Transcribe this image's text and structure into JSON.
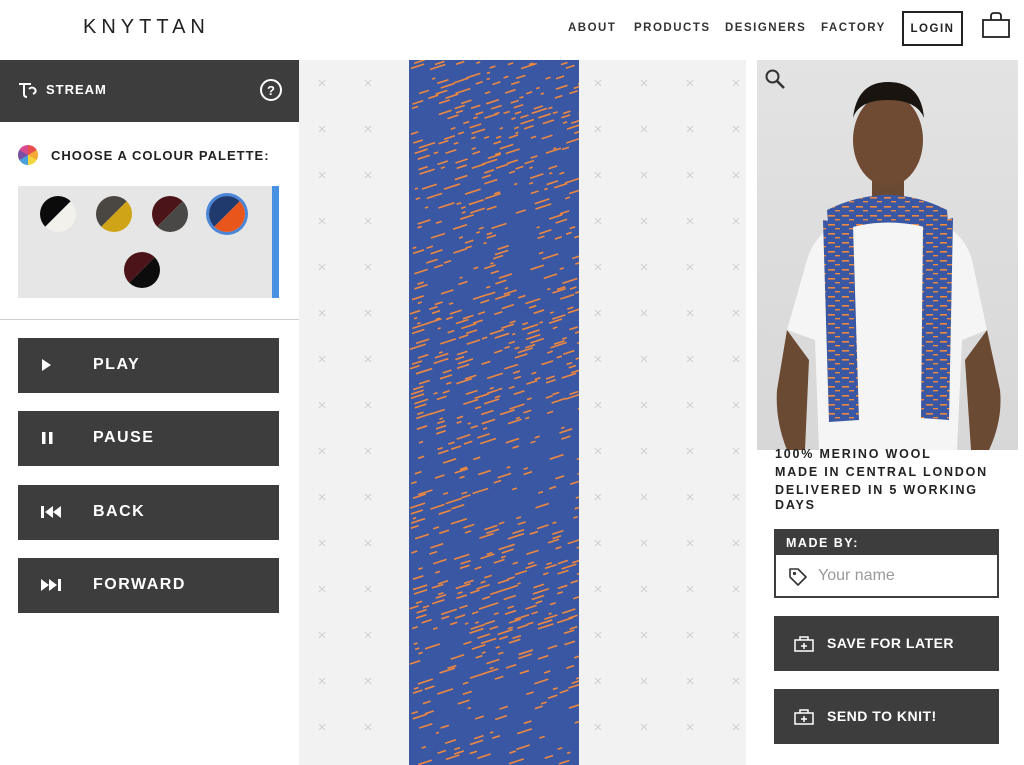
{
  "brand": {
    "logo": "KNYTTAN"
  },
  "nav": {
    "items": [
      {
        "label": "ABOUT"
      },
      {
        "label": "PRODUCTS"
      },
      {
        "label": "DESIGNERS"
      },
      {
        "label": "FACTORY"
      }
    ],
    "login_label": "LOGIN",
    "bag_icon": "shopping-bag-icon"
  },
  "left_panel": {
    "stream_label": "STREAM",
    "stream_icon": "stream-logo-icon",
    "help_label": "?",
    "palette_heading": "CHOOSE A COLOUR PALETTE:",
    "palettes": [
      {
        "colors": [
          "#0b0b0b",
          "#f3f1ec"
        ],
        "selected": false
      },
      {
        "colors": [
          "#4a4742",
          "#cfa417"
        ],
        "selected": false
      },
      {
        "colors": [
          "#4a1418",
          "#4a4846"
        ],
        "selected": false
      },
      {
        "colors": [
          "#213a6e",
          "#e8561c"
        ],
        "selected": true
      },
      {
        "colors": [
          "#4a1418",
          "#0c0c0c"
        ],
        "selected": false
      }
    ],
    "controls": [
      {
        "label": "PLAY",
        "icon": "play-icon"
      },
      {
        "label": "PAUSE",
        "icon": "pause-icon"
      },
      {
        "label": "BACK",
        "icon": "skip-back-icon"
      },
      {
        "label": "FORWARD",
        "icon": "skip-forward-icon"
      }
    ]
  },
  "colors": {
    "panel_dark": "#3d3d3d",
    "scarf_blue": "#3a57a3",
    "scarf_orange": "#f0883e",
    "accent_blue": "#4a90e2"
  },
  "product": {
    "description": [
      "100% MERINO WOOL",
      "MADE IN CENTRAL LONDON",
      "DELIVERED IN 5 WORKING",
      "DAYS"
    ],
    "made_by_label": "MADE BY:",
    "name_placeholder": "Your name",
    "name_value": "",
    "save_label": "SAVE FOR LATER",
    "send_label": "SEND TO KNIT!"
  }
}
